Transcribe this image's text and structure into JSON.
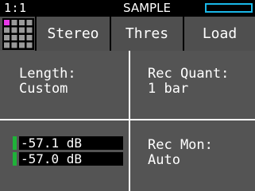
{
  "header": {
    "track": "1:1",
    "title": "SAMPLE",
    "progress_fraction": 0.0,
    "progress_color": "#19b8e8"
  },
  "tabs": {
    "grid_icon": "grid-icon",
    "stereo": "Stereo",
    "thres": "Thres",
    "load": "Load"
  },
  "length": {
    "label": "Length:",
    "value": "Custom"
  },
  "rec_quant": {
    "label": "Rec Quant:",
    "value": "1 bar"
  },
  "levels": {
    "left": "-57.1 dB",
    "right": "-57.0 dB",
    "meter_color": "#1fb239"
  },
  "rec_mon": {
    "label": "Rec Mon:",
    "value": "Auto"
  },
  "colors": {
    "accent_magenta": "#e838e8",
    "panel": "#545454",
    "tab_bg": "#4f4f4f"
  }
}
